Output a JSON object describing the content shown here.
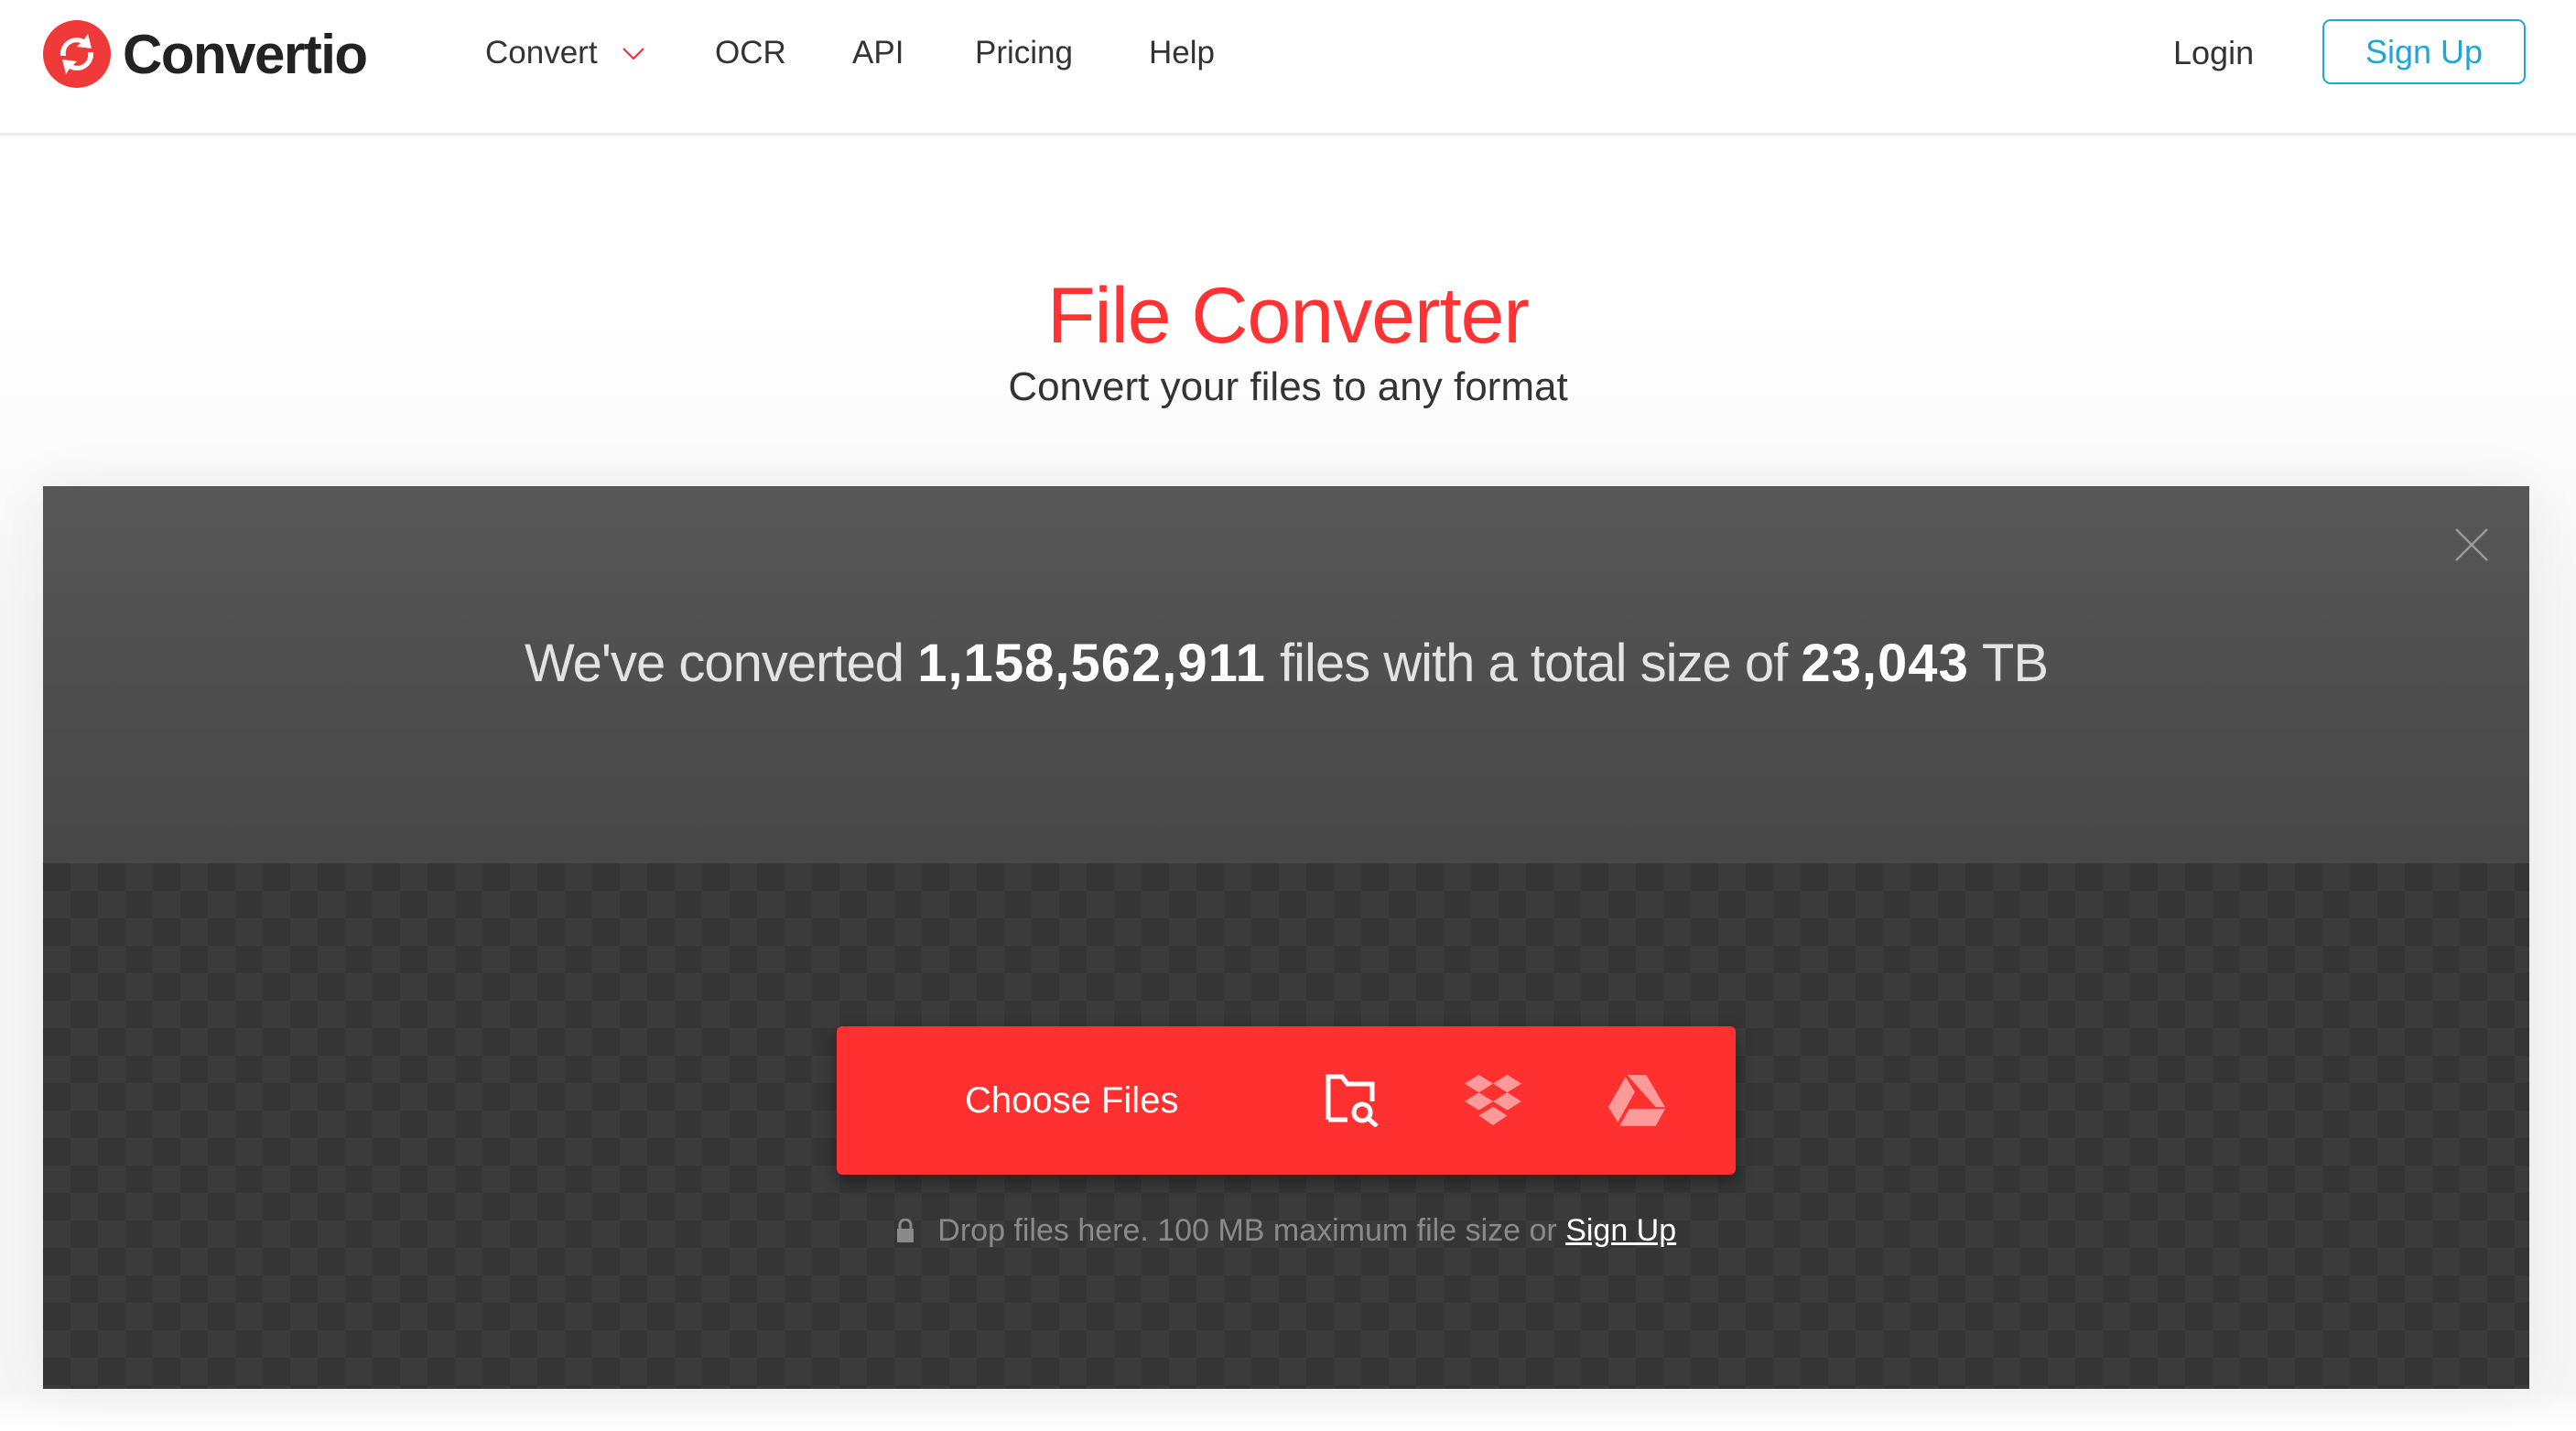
{
  "brand": {
    "name": "Convertio",
    "logo_color": "#f03a3a"
  },
  "nav": {
    "items": [
      {
        "label": "Convert",
        "has_dropdown": true
      },
      {
        "label": "OCR"
      },
      {
        "label": "API"
      },
      {
        "label": "Pricing"
      },
      {
        "label": "Help"
      }
    ],
    "login_label": "Login",
    "signup_label": "Sign Up",
    "accent_color": "#1ea6d8"
  },
  "hero": {
    "title": "File Converter",
    "subtitle": "Convert your files to any format",
    "title_color": "#ff3333"
  },
  "stats": {
    "prefix": "We've converted",
    "files_count": "1,158,562,911",
    "middle": "files with a total size of",
    "total_size": "23,043",
    "unit": "TB"
  },
  "upload": {
    "choose_label": "Choose Files",
    "button_color": "#ff3030",
    "sources": [
      {
        "icon": "folder-search-icon",
        "name": "From Device"
      },
      {
        "icon": "dropbox-icon",
        "name": "From Dropbox"
      },
      {
        "icon": "google-drive-icon",
        "name": "From Google Drive"
      }
    ],
    "note_text": "Drop files here. 100 MB maximum file size or",
    "note_link": "Sign Up"
  }
}
